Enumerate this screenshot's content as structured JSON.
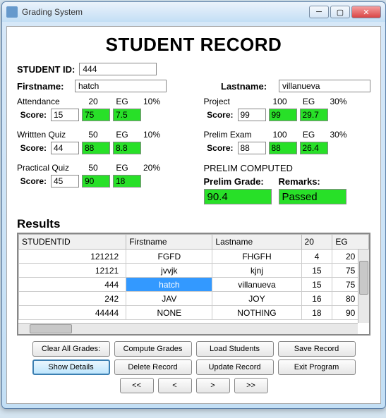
{
  "window": {
    "title": "Grading System"
  },
  "header": {
    "title": "STUDENT RECORD"
  },
  "student": {
    "id_label": "STUDENT ID:",
    "id_value": "444",
    "firstname_label": "Firstname:",
    "firstname_value": "hatch",
    "lastname_label": "Lastname:",
    "lastname_value": "villanueva"
  },
  "left_items": [
    {
      "name": "Attendance",
      "max": "20",
      "eg_label": "EG",
      "pct": "10%",
      "score_label": "Score:",
      "score": "15",
      "eg": "75",
      "weighted": "7.5"
    },
    {
      "name": "Writtten Quiz",
      "max": "50",
      "eg_label": "EG",
      "pct": "10%",
      "score_label": "Score:",
      "score": "44",
      "eg": "88",
      "weighted": "8.8"
    },
    {
      "name": "Practical Quiz",
      "max": "50",
      "eg_label": "EG",
      "pct": "20%",
      "score_label": "Score:",
      "score": "45",
      "eg": "90",
      "weighted": "18"
    }
  ],
  "right_items": [
    {
      "name": "Project",
      "max": "100",
      "eg_label": "EG",
      "pct": "30%",
      "score_label": "Score:",
      "score": "99",
      "eg": "99",
      "weighted": "29.7"
    },
    {
      "name": "Prelim Exam",
      "max": "100",
      "eg_label": "EG",
      "pct": "30%",
      "score_label": "Score:",
      "score": "88",
      "eg": "88",
      "weighted": "26.4"
    }
  ],
  "prelim": {
    "title": "PRELIM COMPUTED",
    "grade_label": "Prelim Grade:",
    "remarks_label": "Remarks:",
    "grade_value": "90.4",
    "remarks_value": "Passed"
  },
  "results": {
    "title": "Results",
    "columns": [
      "STUDENTID",
      "Firstname",
      "Lastname",
      "20",
      "EG"
    ],
    "rows": [
      [
        "121212",
        "FGFD",
        "FHGFH",
        "4",
        "20"
      ],
      [
        "12121",
        "jvvjk",
        "kjnj",
        "15",
        "75"
      ],
      [
        "444",
        "hatch",
        "villanueva",
        "15",
        "75"
      ],
      [
        "242",
        "JAV",
        "JOY",
        "16",
        "80"
      ],
      [
        "44444",
        "NONE",
        "NOTHING",
        "18",
        "90"
      ]
    ],
    "selected": {
      "row": 2,
      "col": 1
    }
  },
  "buttons": {
    "row1": [
      "Clear All Grades:",
      "Compute Grades",
      "Load Students",
      "Save Record"
    ],
    "row2": [
      "Show Details",
      "Delete Record",
      "Update Record",
      "Exit Program"
    ],
    "nav": [
      "<<",
      "<",
      ">",
      ">>"
    ]
  }
}
